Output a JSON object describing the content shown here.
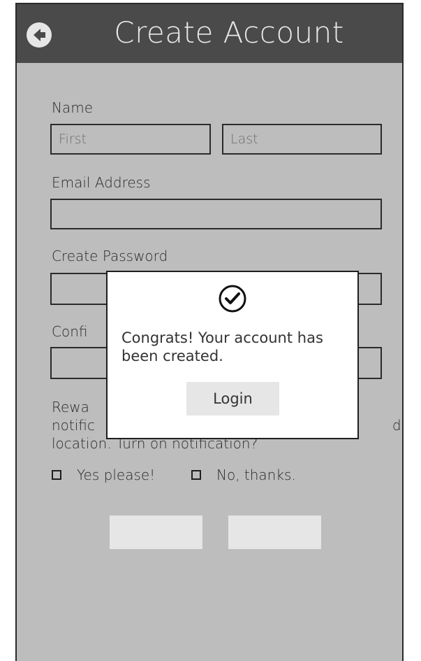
{
  "header": {
    "title": "Create Account",
    "back_icon": "arrow-left-circle-icon"
  },
  "form": {
    "name_label": "Name",
    "first_placeholder": "First",
    "last_placeholder": "Last",
    "email_label": "Email Address",
    "email_value": "",
    "password_label": "Create Password",
    "confirm_label": "Confi",
    "rewards_text": "Rewa\nnotific                                                                   d on\nlocation. Turn on notification?",
    "options": [
      "Yes please!",
      "No, thanks."
    ]
  },
  "buttons": {
    "left_label": "",
    "right_label": ""
  },
  "modal": {
    "icon": "check-circle-icon",
    "message": "Congrats! Your account has been created.",
    "login_label": "Login"
  },
  "colors": {
    "header_bg": "#4a4a4a",
    "page_bg": "#bdbdbd",
    "button_bg": "#e6e6e6",
    "modal_bg": "#ffffff"
  }
}
